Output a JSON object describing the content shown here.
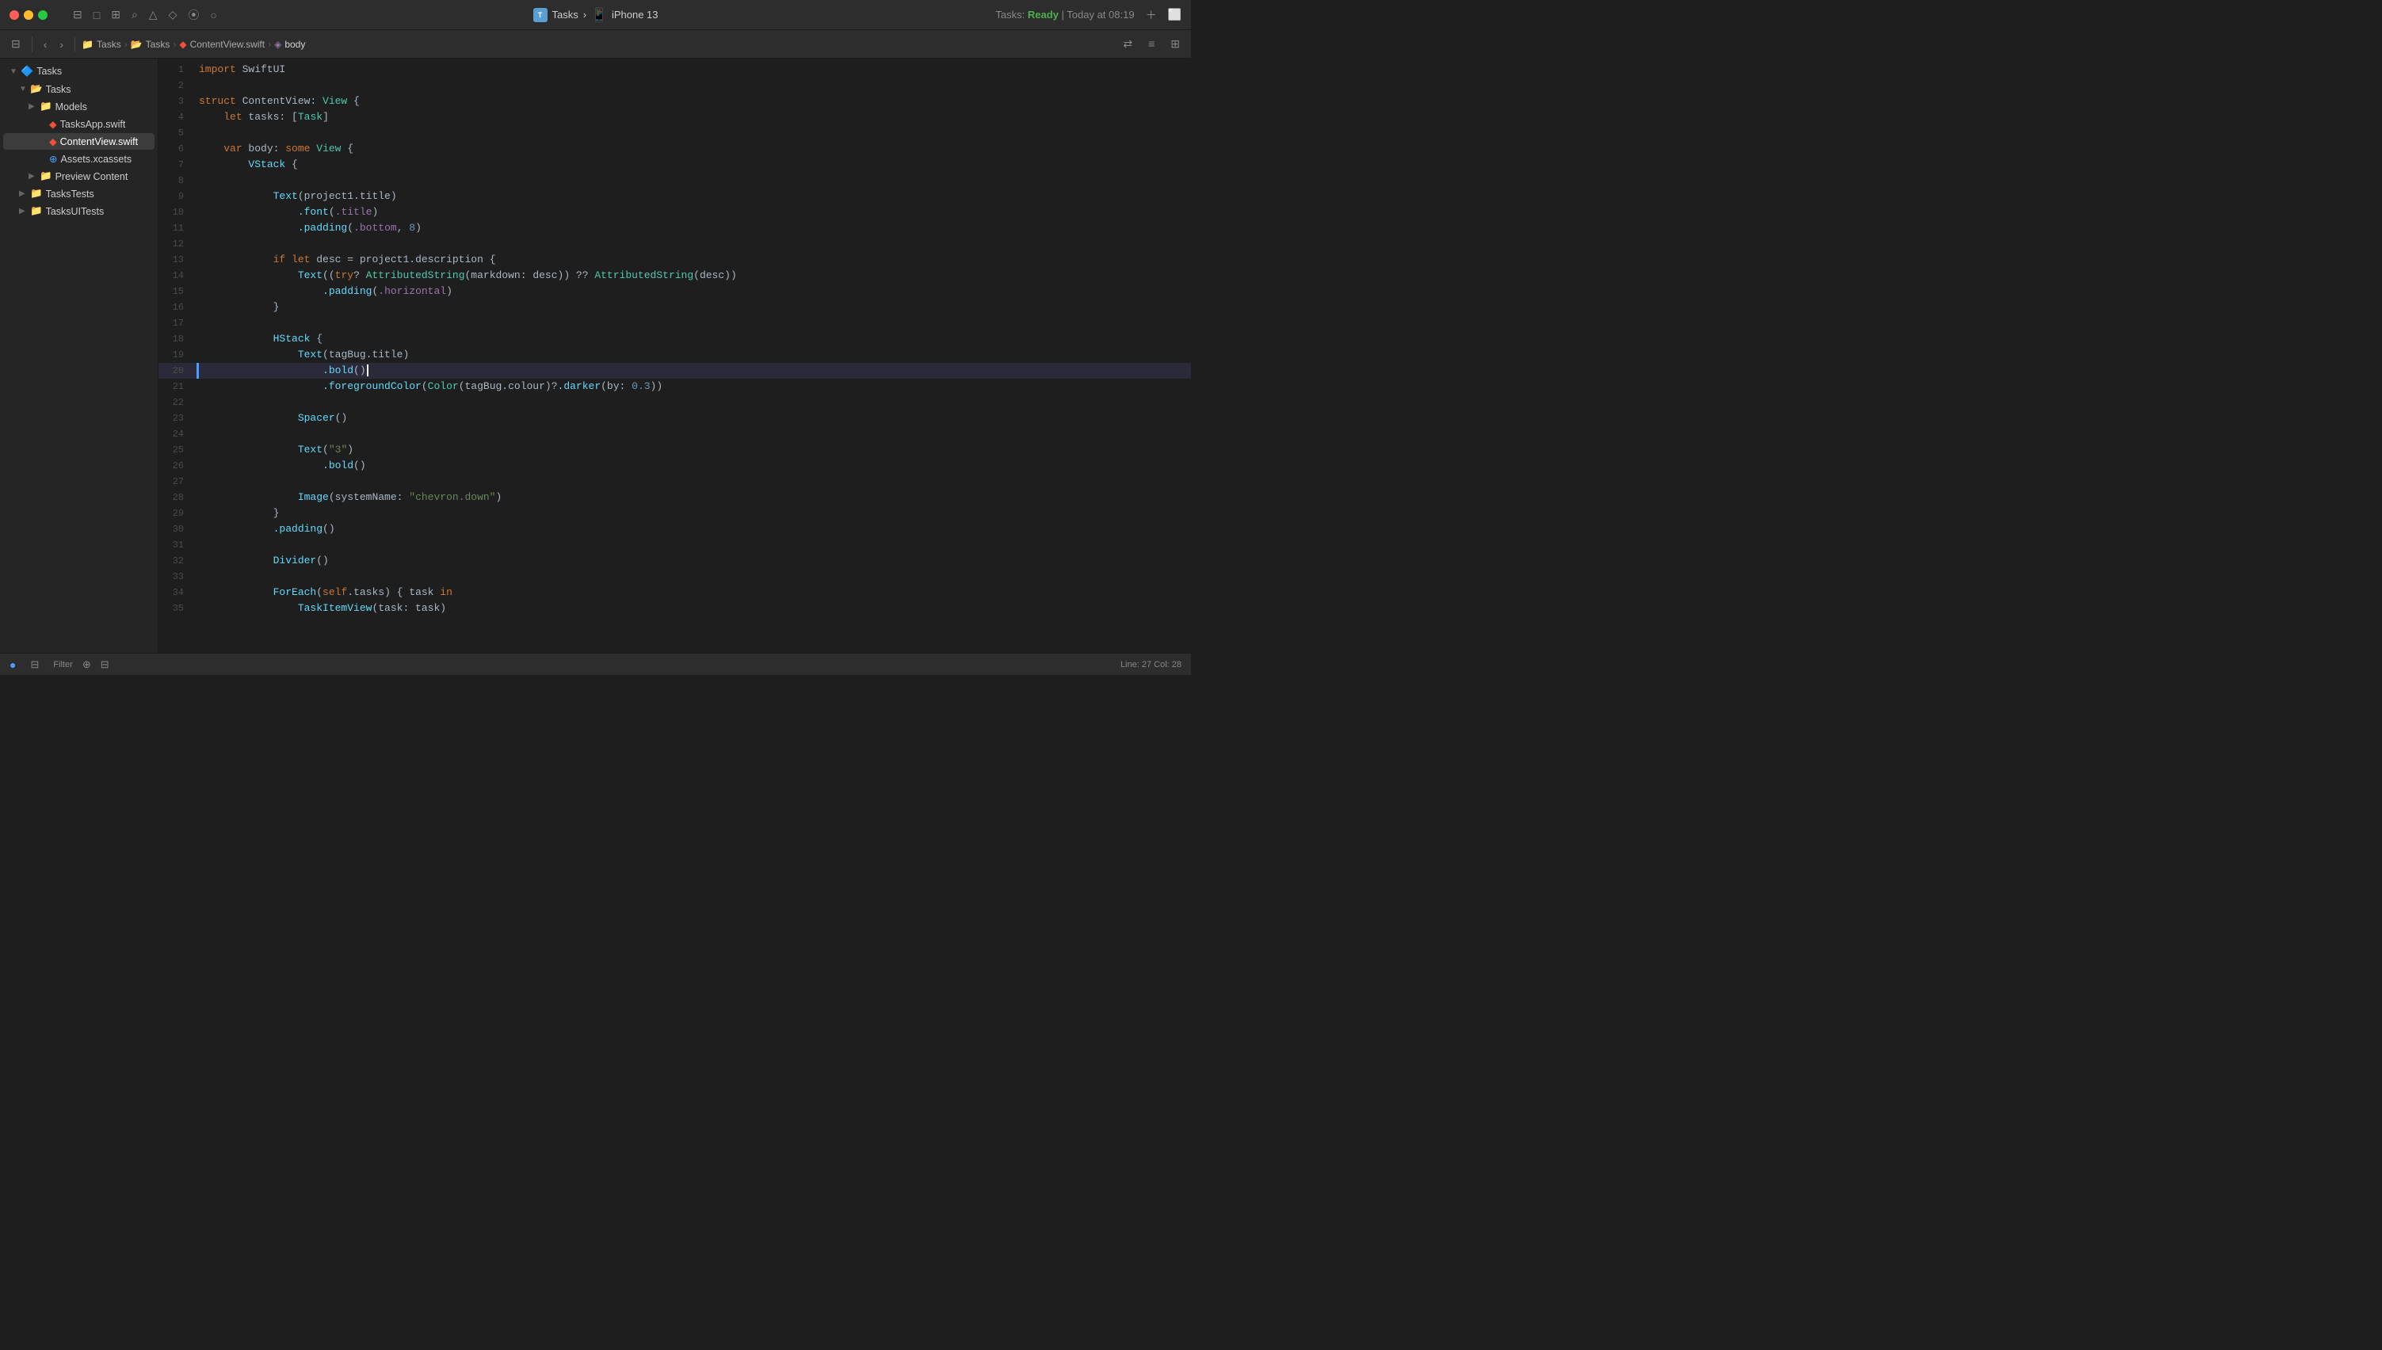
{
  "titleBar": {
    "projectName": "Tasks",
    "deviceName": "iPhone 13",
    "statusText": "Tasks: ",
    "statusReady": "Ready",
    "statusTime": " | Today at 08:19",
    "playBtn": "▶"
  },
  "toolbar": {
    "breadcrumb": [
      "Tasks",
      "Tasks",
      "ContentView.swift",
      "body"
    ],
    "icons": [
      "sidebar",
      "back",
      "forward"
    ]
  },
  "sidebar": {
    "projectLabel": "Tasks",
    "items": [
      {
        "id": "tasks-root",
        "label": "Tasks",
        "indent": 0,
        "type": "project",
        "expanded": true
      },
      {
        "id": "tasks-folder",
        "label": "Tasks",
        "indent": 1,
        "type": "folder",
        "expanded": true
      },
      {
        "id": "models",
        "label": "Models",
        "indent": 2,
        "type": "folder",
        "expanded": false
      },
      {
        "id": "tasksapp",
        "label": "TasksApp.swift",
        "indent": 2,
        "type": "swift"
      },
      {
        "id": "contentview",
        "label": "ContentView.swift",
        "indent": 2,
        "type": "swift",
        "selected": true
      },
      {
        "id": "assets",
        "label": "Assets.xcassets",
        "indent": 2,
        "type": "assets"
      },
      {
        "id": "preview",
        "label": "Preview Content",
        "indent": 2,
        "type": "folder",
        "expanded": false
      },
      {
        "id": "taskstests",
        "label": "TasksTests",
        "indent": 1,
        "type": "folder",
        "expanded": false
      },
      {
        "id": "tasksuites",
        "label": "TasksUITests",
        "indent": 1,
        "type": "folder",
        "expanded": false
      }
    ]
  },
  "editor": {
    "filename": "ContentView.swift",
    "lines": [
      {
        "num": 1,
        "content": "import SwiftUI",
        "tokens": [
          {
            "t": "kw",
            "v": "import"
          },
          {
            "t": "plain",
            "v": " SwiftUI"
          }
        ]
      },
      {
        "num": 2,
        "content": "",
        "tokens": []
      },
      {
        "num": 3,
        "content": "struct ContentView: View {",
        "tokens": [
          {
            "t": "kw",
            "v": "struct"
          },
          {
            "t": "plain",
            "v": " ContentView: "
          },
          {
            "t": "type",
            "v": "View"
          },
          {
            "t": "plain",
            "v": " {"
          }
        ]
      },
      {
        "num": 4,
        "content": "    let tasks: [Task]",
        "tokens": [
          {
            "t": "plain",
            "v": "    "
          },
          {
            "t": "kw",
            "v": "let"
          },
          {
            "t": "plain",
            "v": " tasks: ["
          },
          {
            "t": "type",
            "v": "Task"
          },
          {
            "t": "plain",
            "v": "]"
          }
        ]
      },
      {
        "num": 5,
        "content": "",
        "tokens": []
      },
      {
        "num": 6,
        "content": "    var body: some View {",
        "tokens": [
          {
            "t": "plain",
            "v": "    "
          },
          {
            "t": "kw",
            "v": "var"
          },
          {
            "t": "plain",
            "v": " body: "
          },
          {
            "t": "kw",
            "v": "some"
          },
          {
            "t": "plain",
            "v": " "
          },
          {
            "t": "type",
            "v": "View"
          },
          {
            "t": "plain",
            "v": " {"
          }
        ]
      },
      {
        "num": 7,
        "content": "        VStack {",
        "tokens": [
          {
            "t": "plain",
            "v": "        "
          },
          {
            "t": "func",
            "v": "VStack"
          },
          {
            "t": "plain",
            "v": " {"
          }
        ]
      },
      {
        "num": 8,
        "content": "",
        "tokens": []
      },
      {
        "num": 9,
        "content": "            Text(project1.title)",
        "tokens": [
          {
            "t": "plain",
            "v": "            "
          },
          {
            "t": "func",
            "v": "Text"
          },
          {
            "t": "plain",
            "v": "(project1.title)"
          }
        ]
      },
      {
        "num": 10,
        "content": "                .font(.title)",
        "tokens": [
          {
            "t": "plain",
            "v": "                "
          },
          {
            "t": "dot-method",
            "v": ".font"
          },
          {
            "t": "plain",
            "v": "("
          },
          {
            "t": "param",
            "v": ".title"
          },
          {
            "t": "plain",
            "v": ")"
          }
        ]
      },
      {
        "num": 11,
        "content": "                .padding(.bottom, 8)",
        "tokens": [
          {
            "t": "plain",
            "v": "                "
          },
          {
            "t": "dot-method",
            "v": ".padding"
          },
          {
            "t": "plain",
            "v": "("
          },
          {
            "t": "param",
            "v": ".bottom"
          },
          {
            "t": "plain",
            "v": ", "
          },
          {
            "t": "num",
            "v": "8"
          },
          {
            "t": "plain",
            "v": ")"
          }
        ]
      },
      {
        "num": 12,
        "content": "",
        "tokens": []
      },
      {
        "num": 13,
        "content": "            if let desc = project1.description {",
        "tokens": [
          {
            "t": "plain",
            "v": "            "
          },
          {
            "t": "kw",
            "v": "if"
          },
          {
            "t": "plain",
            "v": " "
          },
          {
            "t": "kw",
            "v": "let"
          },
          {
            "t": "plain",
            "v": " desc = project1.description {"
          }
        ]
      },
      {
        "num": 14,
        "content": "                Text((try? AttributedString(markdown: desc)) ?? AttributedString(desc))",
        "tokens": [
          {
            "t": "plain",
            "v": "                "
          },
          {
            "t": "func",
            "v": "Text"
          },
          {
            "t": "plain",
            "v": "(("
          },
          {
            "t": "kw",
            "v": "try"
          },
          {
            "t": "plain",
            "v": "? "
          },
          {
            "t": "type",
            "v": "AttributedString"
          },
          {
            "t": "plain",
            "v": "(markdown: desc)) ?? "
          },
          {
            "t": "type",
            "v": "AttributedString"
          },
          {
            "t": "plain",
            "v": "(desc))"
          }
        ]
      },
      {
        "num": 15,
        "content": "                    .padding(.horizontal)",
        "tokens": [
          {
            "t": "plain",
            "v": "                    "
          },
          {
            "t": "dot-method",
            "v": ".padding"
          },
          {
            "t": "plain",
            "v": "("
          },
          {
            "t": "param",
            "v": ".horizontal"
          },
          {
            "t": "plain",
            "v": ")"
          }
        ]
      },
      {
        "num": 16,
        "content": "            }",
        "tokens": [
          {
            "t": "plain",
            "v": "            }"
          }
        ]
      },
      {
        "num": 17,
        "content": "",
        "tokens": []
      },
      {
        "num": 18,
        "content": "            HStack {",
        "tokens": [
          {
            "t": "plain",
            "v": "            "
          },
          {
            "t": "func",
            "v": "HStack"
          },
          {
            "t": "plain",
            "v": " {"
          }
        ]
      },
      {
        "num": 19,
        "content": "                Text(tagBug.title)",
        "tokens": [
          {
            "t": "plain",
            "v": "                "
          },
          {
            "t": "func",
            "v": "Text"
          },
          {
            "t": "plain",
            "v": "(tagBug.title)"
          }
        ]
      },
      {
        "num": 20,
        "content": "                    .bold()",
        "tokens": [
          {
            "t": "plain",
            "v": "                    "
          },
          {
            "t": "dot-method",
            "v": ".bold"
          },
          {
            "t": "plain",
            "v": "()"
          }
        ],
        "highlighted": true,
        "cursor": true
      },
      {
        "num": 21,
        "content": "                    .foregroundColor(Color(tagBug.colour)?.darker(by: 0.3))",
        "tokens": [
          {
            "t": "plain",
            "v": "                    "
          },
          {
            "t": "dot-method",
            "v": ".foregroundColor"
          },
          {
            "t": "plain",
            "v": "("
          },
          {
            "t": "type",
            "v": "Color"
          },
          {
            "t": "plain",
            "v": "(tagBug.colour)?"
          },
          {
            "t": "dot-method",
            "v": ".darker"
          },
          {
            "t": "plain",
            "v": "(by: "
          },
          {
            "t": "num",
            "v": "0.3"
          },
          {
            "t": "plain",
            "v": "))"
          }
        ]
      },
      {
        "num": 22,
        "content": "",
        "tokens": []
      },
      {
        "num": 23,
        "content": "                Spacer()",
        "tokens": [
          {
            "t": "plain",
            "v": "                "
          },
          {
            "t": "func",
            "v": "Spacer"
          },
          {
            "t": "plain",
            "v": "()"
          }
        ]
      },
      {
        "num": 24,
        "content": "",
        "tokens": []
      },
      {
        "num": 25,
        "content": "                Text(\"3\")",
        "tokens": [
          {
            "t": "plain",
            "v": "                "
          },
          {
            "t": "func",
            "v": "Text"
          },
          {
            "t": "plain",
            "v": "("
          },
          {
            "t": "str",
            "v": "\"3\""
          },
          {
            "t": "plain",
            "v": ")"
          }
        ]
      },
      {
        "num": 26,
        "content": "                    .bold()",
        "tokens": [
          {
            "t": "plain",
            "v": "                    "
          },
          {
            "t": "dot-method",
            "v": ".bold"
          },
          {
            "t": "plain",
            "v": "()"
          }
        ]
      },
      {
        "num": 27,
        "content": "",
        "tokens": []
      },
      {
        "num": 28,
        "content": "                Image(systemName: \"chevron.down\")",
        "tokens": [
          {
            "t": "plain",
            "v": "                "
          },
          {
            "t": "func",
            "v": "Image"
          },
          {
            "t": "plain",
            "v": "(systemName: "
          },
          {
            "t": "str",
            "v": "\"chevron.down\""
          },
          {
            "t": "plain",
            "v": ")"
          }
        ]
      },
      {
        "num": 29,
        "content": "            }",
        "tokens": [
          {
            "t": "plain",
            "v": "            }"
          }
        ]
      },
      {
        "num": 30,
        "content": "            .padding()",
        "tokens": [
          {
            "t": "plain",
            "v": "            "
          },
          {
            "t": "dot-method",
            "v": ".padding"
          },
          {
            "t": "plain",
            "v": "()"
          }
        ]
      },
      {
        "num": 31,
        "content": "",
        "tokens": []
      },
      {
        "num": 32,
        "content": "            Divider()",
        "tokens": [
          {
            "t": "plain",
            "v": "            "
          },
          {
            "t": "func",
            "v": "Divider"
          },
          {
            "t": "plain",
            "v": "()"
          }
        ]
      },
      {
        "num": 33,
        "content": "",
        "tokens": []
      },
      {
        "num": 34,
        "content": "            ForEach(self.tasks) { task in",
        "tokens": [
          {
            "t": "plain",
            "v": "            "
          },
          {
            "t": "func",
            "v": "ForEach"
          },
          {
            "t": "plain",
            "v": "("
          },
          {
            "t": "kw",
            "v": "self"
          },
          {
            "t": "plain",
            "v": ".tasks) { task "
          },
          {
            "t": "kw",
            "v": "in"
          }
        ]
      },
      {
        "num": 35,
        "content": "                TaskItemView(task: task)",
        "tokens": [
          {
            "t": "plain",
            "v": "                "
          },
          {
            "t": "func",
            "v": "TaskItemView"
          },
          {
            "t": "plain",
            "v": "(task: task)"
          }
        ]
      }
    ]
  },
  "statusBar": {
    "lineCol": "Line: 27  Col: 28",
    "filterLabel": "Filter",
    "indicator": "●"
  }
}
